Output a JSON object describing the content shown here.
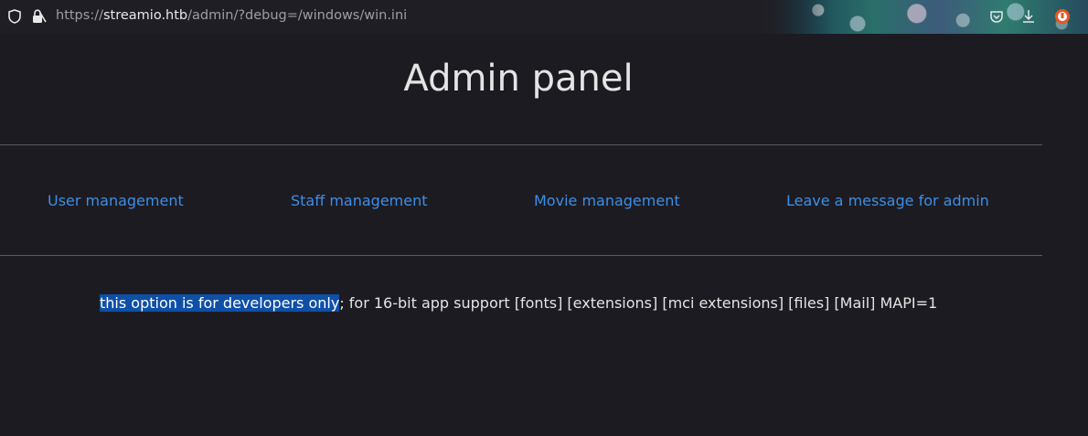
{
  "browser": {
    "url_protocol": "https://",
    "url_host": "streamio.htb",
    "url_path": "/admin/?debug=/windows/win.ini"
  },
  "page": {
    "title": "Admin panel",
    "nav": [
      {
        "label": "User management"
      },
      {
        "label": "Staff management"
      },
      {
        "label": "Movie management"
      },
      {
        "label": "Leave a message for admin"
      }
    ],
    "output_selected": "this option is for developers only",
    "output_rest": "; for 16-bit app support [fonts] [extensions] [mci extensions] [files] [Mail] MAPI=1"
  },
  "colors": {
    "background": "#1c1b22",
    "link": "#3b8fe6",
    "selection": "#0e4fa8"
  }
}
